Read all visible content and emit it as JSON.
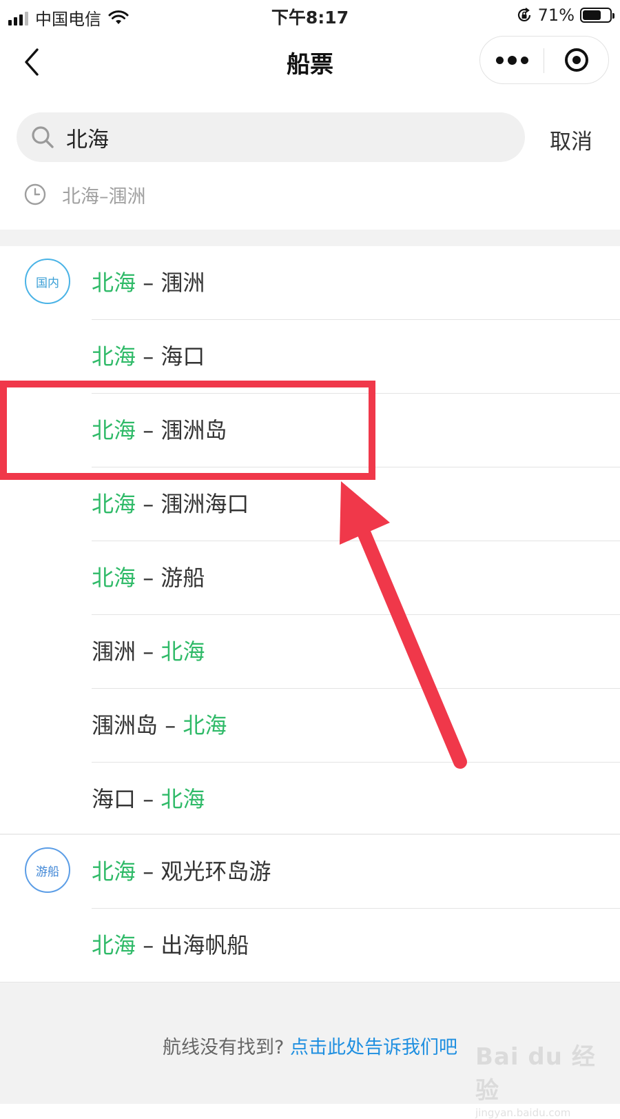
{
  "status_bar": {
    "carrier": "中国电信",
    "time": "下午8:17",
    "battery": "71%",
    "battery_level": 0.71,
    "signal_icon": "signal-icon",
    "wifi_icon": "wifi-icon"
  },
  "nav": {
    "title": "船票",
    "back_icon": "chevron-left-icon",
    "more_icon": "more-dots-icon",
    "close_icon": "target-close-icon"
  },
  "search": {
    "value": "北海",
    "cancel_label": "取消",
    "icon": "search-icon"
  },
  "history": {
    "icon": "clock-icon",
    "items": [
      "北海–涠洲"
    ]
  },
  "groups": [
    {
      "badge": "国内",
      "rows": [
        {
          "from": "北海",
          "sep": " – ",
          "to": "涠洲"
        },
        {
          "from": "北海",
          "sep": " – ",
          "to": "海口"
        },
        {
          "from": "北海",
          "sep": " – ",
          "to": "涠洲岛"
        },
        {
          "from": "北海",
          "sep": " – ",
          "to": "涠洲海口"
        },
        {
          "from": "北海",
          "sep": " – ",
          "to": "游船"
        },
        {
          "from": "涠洲",
          "sep": " – ",
          "to": "北海"
        },
        {
          "from": "涠洲岛",
          "sep": " – ",
          "to": "北海"
        },
        {
          "from": "海口",
          "sep": " – ",
          "to": "北海"
        }
      ]
    },
    {
      "badge": "游船",
      "rows": [
        {
          "from": "北海",
          "sep": " – ",
          "to": "观光环岛游"
        },
        {
          "from": "北海",
          "sep": " – ",
          "to": "出海帆船"
        }
      ]
    }
  ],
  "footer": {
    "prompt": "航线没有找到?",
    "link": "点击此处告诉我们吧"
  },
  "watermark": {
    "main": "Bai du 经验",
    "sub": "jingyan.baidu.com"
  },
  "colors": {
    "highlight": "#2fba68",
    "link": "#1f8fe0",
    "annotation": "#f0384a"
  }
}
